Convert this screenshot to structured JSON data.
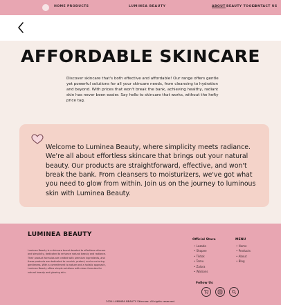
{
  "nav": {
    "home": "HOME",
    "products": "PRODUCTS",
    "brand": "LUMINEA BEAUTY",
    "about": "ABOUT",
    "beauty_tools": "BEAUTY TOOLS",
    "contact": "CONTACT US"
  },
  "hero": {
    "title": "AFFORDABLE SKINCARE",
    "description": "Discover skincare that's both effective and affordable! Our range offers gentle yet powerful solutions for all your skincare needs, from cleansing to hydration and beyond. With prices that won't break the bank, achieving healthy, radiant skin has never been easier. Say hello to skincare that works, without the hefty price tag."
  },
  "welcome": {
    "text": "Welcome to Luminea Beauty, where simplicity meets radiance. We're all about effortless skincare that brings out your natural beauty. Our products are straightforward, effective, and won't break the bank. From cleansers to moisturizers, we've got what you need to glow from within. Join us on the journey to luminous skin with Luminea Beauty."
  },
  "footer": {
    "brand": "LUMINEA BEAUTY",
    "about": "Luminea Beauty is a skincare brand devoted to effortless skincare and simplicity, dedicated to enhance natural beauty and radiance. Their product formulas are crafted with premium ingredients, and these products are dedicated to nourish, protect, and a nurturing gentleness. With a commitment to nature and a holistic approach, Luminea Beauty offers simple solutions with clean formulas for natural beauty and glowing skin.",
    "official_store_title": "Official Store",
    "official_store_items": [
      "Lazada",
      "Shopee",
      "Tiktok",
      "Temu",
      "Zalora",
      "Watsons"
    ],
    "menu_title": "MENU",
    "menu_items": [
      "Home",
      "Products",
      "About",
      "Blog"
    ],
    "follow_title": "Follow Us",
    "copyright": "2024 LUMINEA BEAUTY Skincare. All rights reserved."
  },
  "colors": {
    "accent_pink": "#e8a6b2",
    "hero_bg": "#f6ede8",
    "card_bg": "#f4d3c9"
  },
  "icons": {
    "back": "chevron-left-icon",
    "heart": "heart-icon",
    "social": [
      "cart-icon",
      "instagram-icon",
      "search-icon"
    ]
  }
}
